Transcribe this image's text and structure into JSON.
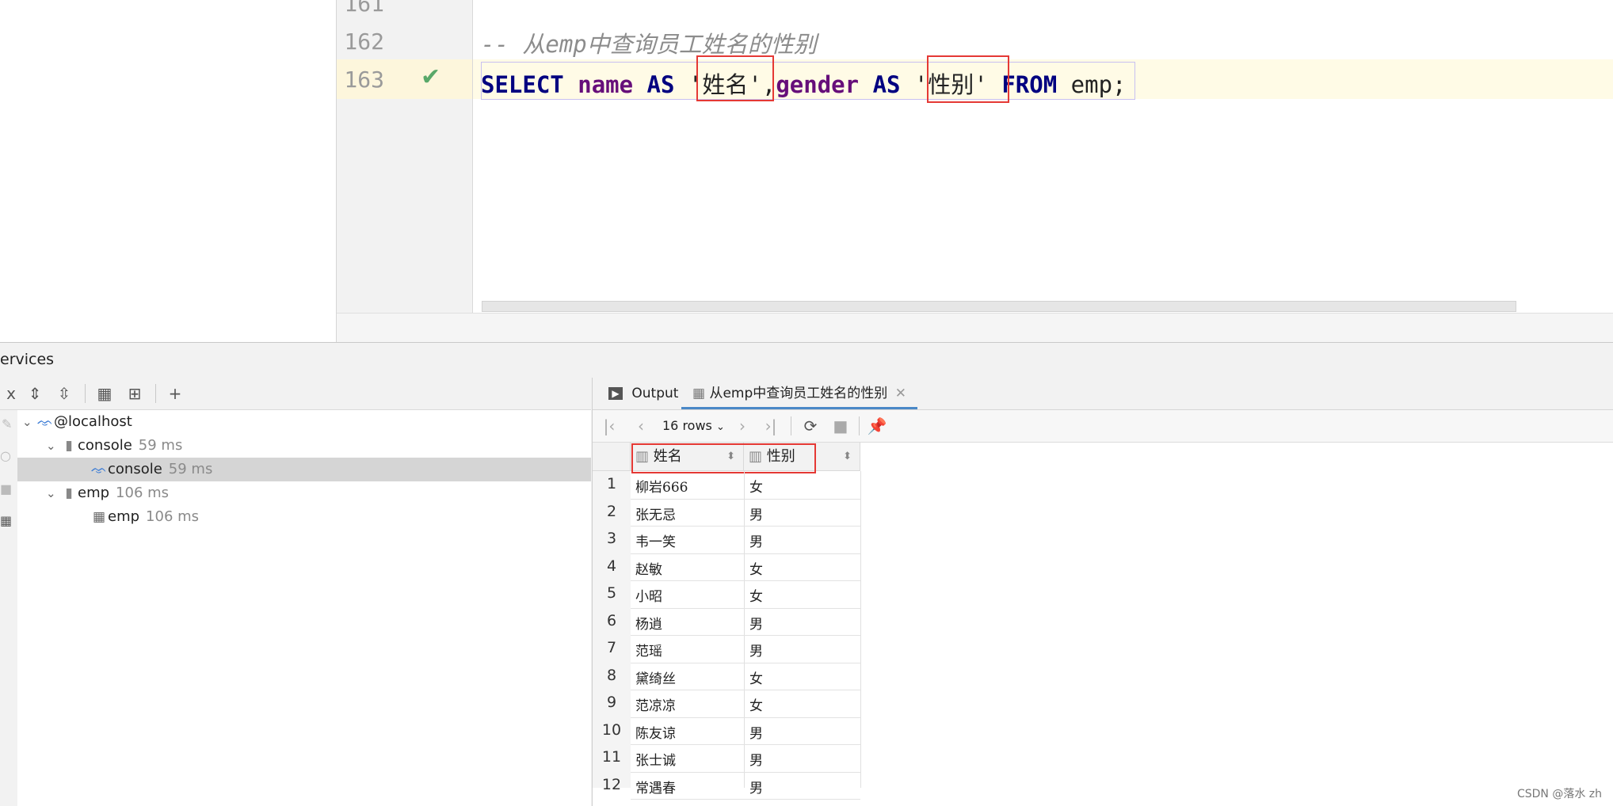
{
  "editor": {
    "line_numbers": [
      "161",
      "162",
      "163"
    ],
    "comment": "-- 从emp中查询员工姓名的性别",
    "sql": {
      "kw_select": "SELECT",
      "name": "name",
      "as1": "AS",
      "alias1": "'姓名'",
      "comma": ",",
      "gender": "gender",
      "as2": "AS",
      "alias2": "'性别'",
      "from": "FROM",
      "table": "emp",
      "semi": ";"
    },
    "check_icon": "✔"
  },
  "services": {
    "title": "ervices",
    "tree": [
      {
        "label": "@localhost",
        "time": ""
      },
      {
        "label": "console",
        "time": "59 ms"
      },
      {
        "label": "console",
        "time": "59 ms"
      },
      {
        "label": "emp",
        "time": "106 ms"
      },
      {
        "label": "emp",
        "time": "106 ms"
      }
    ]
  },
  "results": {
    "tab_output": "Output",
    "tab_query": "从emp中查询员工姓名的性别",
    "rows_label": "16 rows",
    "columns": [
      "姓名",
      "性别"
    ],
    "rows": [
      [
        "柳岩666",
        "女"
      ],
      [
        "张无忌",
        "男"
      ],
      [
        "韦一笑",
        "男"
      ],
      [
        "赵敏",
        "女"
      ],
      [
        "小昭",
        "女"
      ],
      [
        "杨逍",
        "男"
      ],
      [
        "范瑶",
        "男"
      ],
      [
        "黛绮丝",
        "女"
      ],
      [
        "范凉凉",
        "女"
      ],
      [
        "陈友谅",
        "男"
      ],
      [
        "张士诚",
        "男"
      ],
      [
        "常遇春",
        "男"
      ]
    ],
    "row_numbers": [
      "1",
      "2",
      "3",
      "4",
      "5",
      "6",
      "7",
      "8",
      "9",
      "10",
      "11",
      "12"
    ]
  },
  "watermark": "CSDN @落水 zh"
}
